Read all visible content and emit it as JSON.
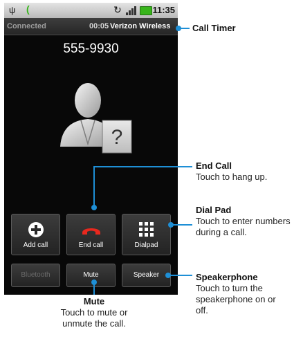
{
  "status_bar": {
    "time": "11:35",
    "icons": [
      "usb-icon",
      "call-icon",
      "sync-icon",
      "signal-icon",
      "battery-icon"
    ]
  },
  "call_info": {
    "state": "Connected",
    "timer": "00:05",
    "carrier": "Verizon Wireless"
  },
  "phone_number": "555-9930",
  "buttons_row1": [
    {
      "label": "Add call",
      "icon": "plus-icon"
    },
    {
      "label": "End call",
      "icon": "end-call-icon"
    },
    {
      "label": "Dialpad",
      "icon": "dialpad-icon"
    }
  ],
  "buttons_row2": [
    {
      "label": "Bluetooth"
    },
    {
      "label": "Mute"
    },
    {
      "label": "Speaker"
    }
  ],
  "callouts": {
    "call_timer": {
      "title": "Call Timer"
    },
    "end_call": {
      "title": "End Call",
      "desc": "Touch to hang up."
    },
    "dial_pad": {
      "title": "Dial Pad",
      "desc": "Touch to enter numbers during a call."
    },
    "speakerphone": {
      "title": "Speakerphone",
      "desc": "Touch to turn the speakerphone on or off."
    },
    "mute": {
      "title": "Mute",
      "desc": "Touch to mute or unmute the call."
    }
  },
  "colors": {
    "callout": "#1e8fd6",
    "end_call_red": "#e8281e",
    "battery_green": "#38b51b"
  }
}
